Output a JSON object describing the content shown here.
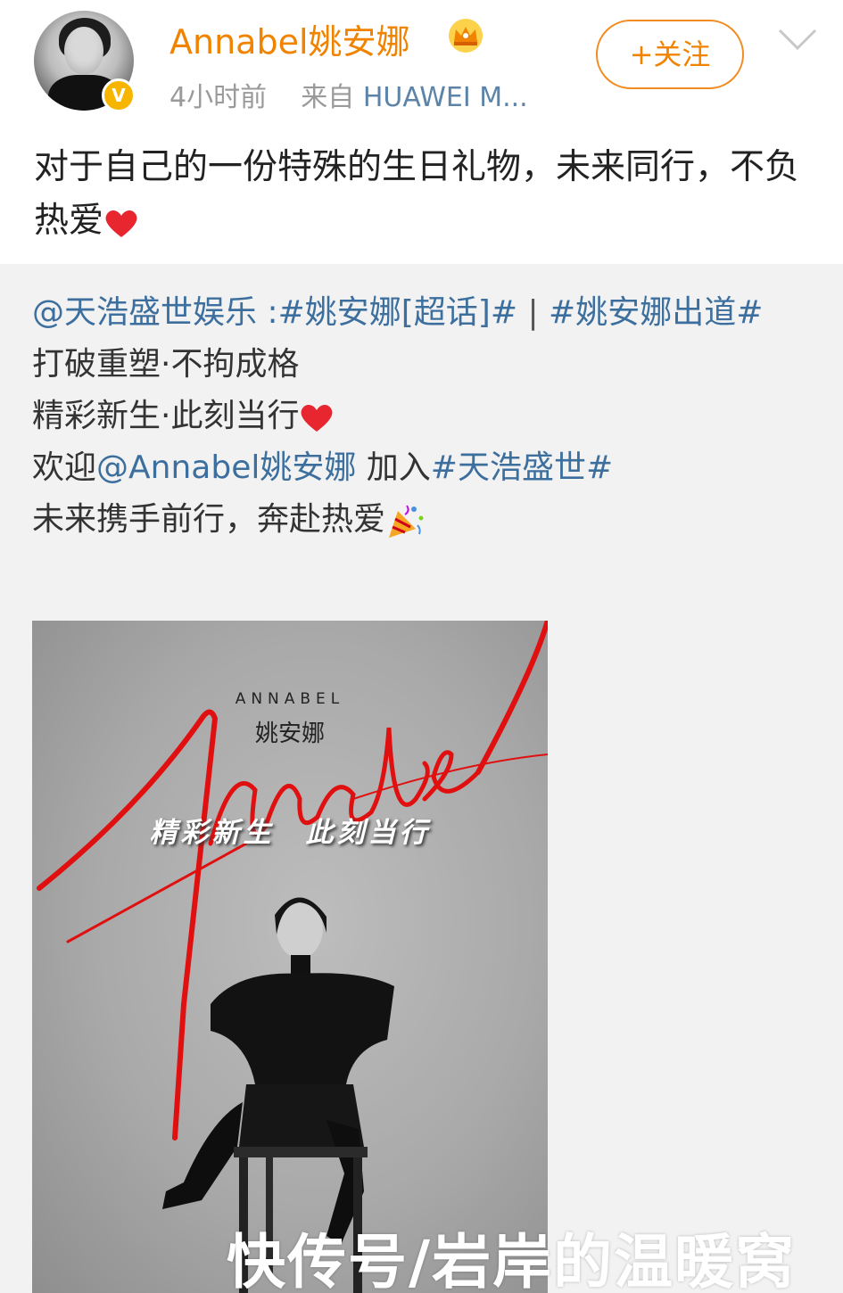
{
  "post": {
    "username": "Annabel姚安娜",
    "time": "4小时前",
    "source_prefix": "来自",
    "source_device": "HUAWEI M...",
    "follow_label": "+关注",
    "text_main": "对于自己的一份特殊的生日礼物，未来同行，不负热爱"
  },
  "repost": {
    "mention_company": "@天浩盛世娱乐",
    "colon": " :",
    "hashtag_supertopic": "#姚安娜[超话]#",
    "separator": " | ",
    "hashtag_debut": "#姚安娜出道#",
    "line2": "打破重塑·不拘成格",
    "line3": "精彩新生·此刻当行",
    "line4_prefix": "欢迎",
    "line4_mention": "@Annabel姚安娜",
    "line4_middle": " 加入",
    "line4_hashtag": "#天浩盛世#",
    "line5": "未来携手前行，奔赴热爱"
  },
  "poster": {
    "brand": "ANNABEL",
    "chinese_name": "姚安娜",
    "tagline": "精彩新生　此刻当行",
    "script_text": "Annabel"
  },
  "watermark": "快传号/岩岸的温暖窝",
  "colors": {
    "username": "#f08300",
    "link": "#3d6f9e",
    "follow_border": "#f28b20",
    "script_red": "#e01010"
  }
}
